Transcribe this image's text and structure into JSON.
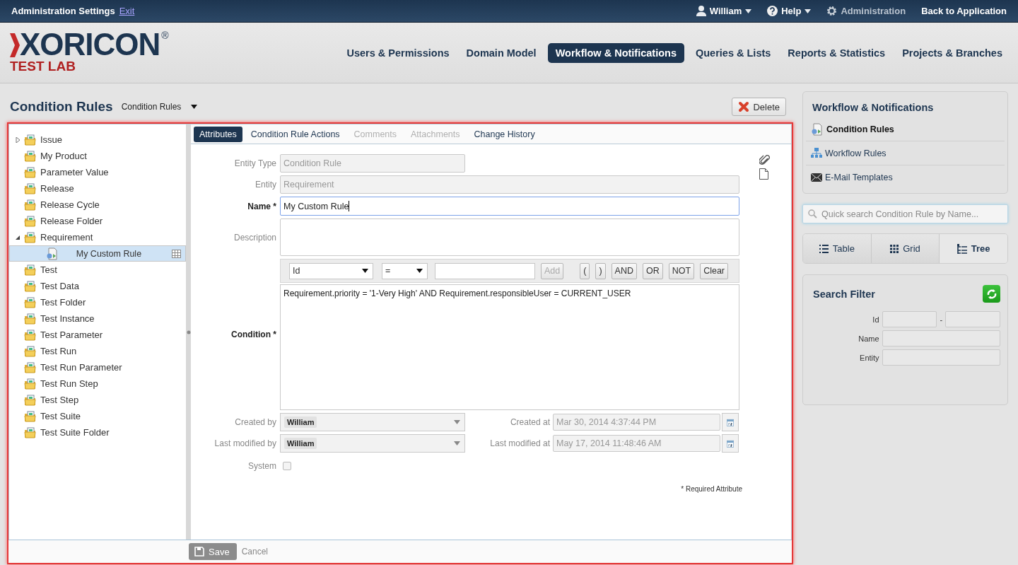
{
  "top_bar": {
    "title": "Administration Settings",
    "exit_link": "Exit",
    "user_menu": "William",
    "help_menu": "Help",
    "admin_label": "Administration",
    "back_link": "Back to Application"
  },
  "logo": {
    "name": "XORICON",
    "registered": "®",
    "subtitle": "TEST LAB"
  },
  "nav": [
    {
      "label": "Users & Permissions",
      "selected": false
    },
    {
      "label": "Domain Model",
      "selected": false
    },
    {
      "label": "Workflow & Notifications",
      "selected": true
    },
    {
      "label": "Queries & Lists",
      "selected": false
    },
    {
      "label": "Reports & Statistics",
      "selected": false
    },
    {
      "label": "Projects & Branches",
      "selected": false
    }
  ],
  "page": {
    "title": "Condition Rules",
    "view_select": "Condition Rules",
    "delete_button": "Delete"
  },
  "tree": [
    {
      "label": "Issue",
      "kind": "folder",
      "selected": false,
      "expanded": false
    },
    {
      "label": "My Product",
      "kind": "folder",
      "selected": false
    },
    {
      "label": "Parameter Value",
      "kind": "folder",
      "selected": false
    },
    {
      "label": "Release",
      "kind": "folder",
      "selected": false
    },
    {
      "label": "Release Cycle",
      "kind": "folder",
      "selected": false
    },
    {
      "label": "Release Folder",
      "kind": "folder",
      "selected": false
    },
    {
      "label": "Requirement",
      "kind": "folder",
      "selected": false,
      "expanded": true,
      "children": [
        {
          "label": "My Custom Rule",
          "kind": "rule",
          "selected": true
        }
      ]
    },
    {
      "label": "Test",
      "kind": "folder",
      "selected": false
    },
    {
      "label": "Test Data",
      "kind": "folder",
      "selected": false
    },
    {
      "label": "Test Folder",
      "kind": "folder",
      "selected": false
    },
    {
      "label": "Test Instance",
      "kind": "folder",
      "selected": false
    },
    {
      "label": "Test Parameter",
      "kind": "folder",
      "selected": false
    },
    {
      "label": "Test Run",
      "kind": "folder",
      "selected": false
    },
    {
      "label": "Test Run Parameter",
      "kind": "folder",
      "selected": false
    },
    {
      "label": "Test Run Step",
      "kind": "folder",
      "selected": false
    },
    {
      "label": "Test Step",
      "kind": "folder",
      "selected": false
    },
    {
      "label": "Test Suite",
      "kind": "folder",
      "selected": false
    },
    {
      "label": "Test Suite Folder",
      "kind": "folder",
      "selected": false
    }
  ],
  "tabs": [
    {
      "label": "Attributes",
      "selected": true,
      "disabled": false
    },
    {
      "label": "Condition Rule Actions",
      "selected": false,
      "disabled": false
    },
    {
      "label": "Comments",
      "selected": false,
      "disabled": true
    },
    {
      "label": "Attachments",
      "selected": false,
      "disabled": true
    },
    {
      "label": "Change History",
      "selected": false,
      "disabled": false
    }
  ],
  "form": {
    "entity_type": {
      "label": "Entity Type",
      "value": "Condition Rule"
    },
    "entity": {
      "label": "Entity",
      "value": "Requirement"
    },
    "name": {
      "label": "Name",
      "required_mark": "*",
      "value": "My Custom Rule"
    },
    "description": {
      "label": "Description"
    },
    "condition": {
      "label": "Condition",
      "required_mark": "*",
      "field_select": "Id",
      "operator_select": "=",
      "add_button": {
        "label": "Add",
        "disabled": true
      },
      "operator_buttons": [
        "(",
        ")",
        "AND",
        "OR",
        "NOT",
        "Clear"
      ],
      "expression": "Requirement.priority = '1-Very High' AND Requirement.responsibleUser = CURRENT_USER"
    },
    "created_by": {
      "label": "Created by",
      "value": "William"
    },
    "created_at": {
      "label": "Created at",
      "value": "Mar 30, 2014 4:37:44 PM"
    },
    "last_modified_by": {
      "label": "Last modified by",
      "value": "William"
    },
    "last_modified_at": {
      "label": "Last modified at",
      "value": "May 17, 2014 11:48:46 AM"
    },
    "system": {
      "label": "System",
      "checked": false
    },
    "required_note": "* Required Attribute"
  },
  "footer": {
    "save_button": "Save",
    "cancel_link": "Cancel"
  },
  "sidebar": {
    "title": "Workflow & Notifications",
    "items": [
      {
        "label": "Condition Rules",
        "kind": "rule",
        "selected": true
      },
      {
        "label": "Workflow Rules",
        "kind": "workflow",
        "selected": false
      },
      {
        "label": "E-Mail Templates",
        "kind": "mail",
        "selected": false
      }
    ],
    "quick_search": {
      "placeholder": "Quick search Condition Rule by Name..."
    },
    "views": [
      {
        "label": "Table",
        "kind": "table",
        "selected": false
      },
      {
        "label": "Grid",
        "kind": "grid",
        "selected": false
      },
      {
        "label": "Tree",
        "kind": "tree",
        "selected": true
      }
    ],
    "search_filter": {
      "title": "Search Filter",
      "id_label": "Id",
      "id_separator": "-",
      "name_label": "Name",
      "entity_label": "Entity"
    }
  }
}
